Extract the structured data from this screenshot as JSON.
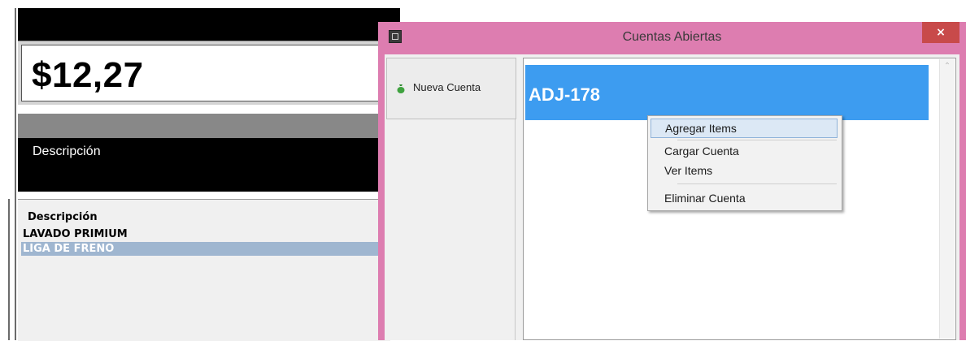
{
  "pos": {
    "total": "$12,27",
    "description_header": "Descripción",
    "list_header": "Descripción",
    "items": [
      "LAVADO PRIMIUM",
      "LIGA DE FRENO"
    ]
  },
  "dialog": {
    "title": "Cuentas Abiertas",
    "close_glyph": "×",
    "new_account_label": "Nueva Cuenta",
    "accounts": [
      "ADJ-178"
    ]
  },
  "context_menu": {
    "items": [
      "Agregar Items",
      "Cargar Cuenta",
      "Ver Items",
      "Eliminar Cuenta"
    ],
    "highlighted": "Agregar Items"
  },
  "icons": {
    "app": "app-icon",
    "new_account": "money-bag-icon",
    "close": "close-icon",
    "scroll_up": "scroll-up-arrow-icon"
  },
  "colors": {
    "dialog_frame": "#dd7db0",
    "selection": "#3d9cf0",
    "close_button": "#c84a4a",
    "row_selected": "#9fb6d0"
  }
}
